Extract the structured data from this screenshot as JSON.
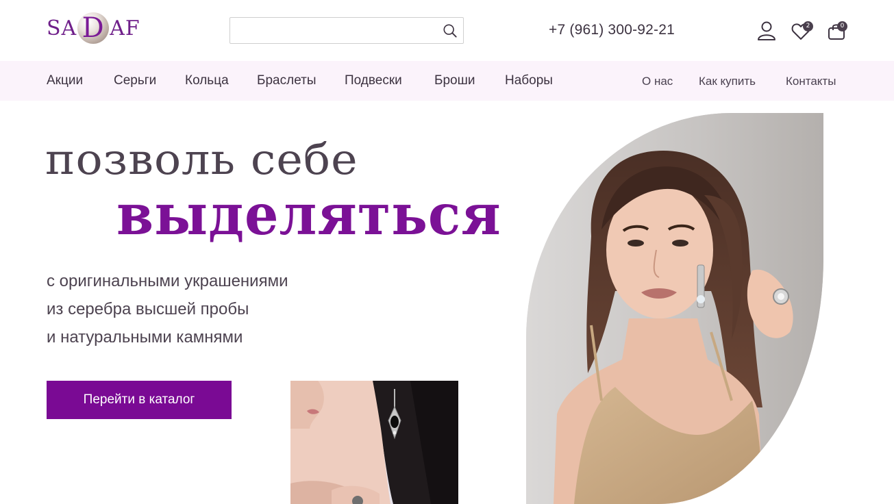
{
  "brand": {
    "logo_left": "SA",
    "logo_middle": "D",
    "logo_right": "AF"
  },
  "search": {
    "value": "",
    "placeholder": "",
    "icon": "search-icon"
  },
  "header": {
    "phone": "+7 (961) 300-92-21",
    "favorites_count": "2",
    "cart_count": "0"
  },
  "nav": {
    "categories": [
      {
        "label": "Акции"
      },
      {
        "label": "Серьги"
      },
      {
        "label": "Кольца"
      },
      {
        "label": "Браслеты"
      },
      {
        "label": "Подвески"
      },
      {
        "label": "Броши"
      },
      {
        "label": "Наборы"
      }
    ],
    "info": [
      {
        "label": "О нас"
      },
      {
        "label": "Как купить"
      },
      {
        "label": "Контакты"
      }
    ]
  },
  "hero": {
    "title_line1": "позволь себе",
    "title_line2": "выделяться",
    "subtitle_lines": [
      "с оригинальными украшениями",
      "из серебра высшей пробы",
      "и натуральными камнями"
    ],
    "cta_label": "Перейти в каталог"
  },
  "colors": {
    "accent": "#7a0a94",
    "nav_background": "#fbf3fb",
    "text": "#3c3240"
  }
}
